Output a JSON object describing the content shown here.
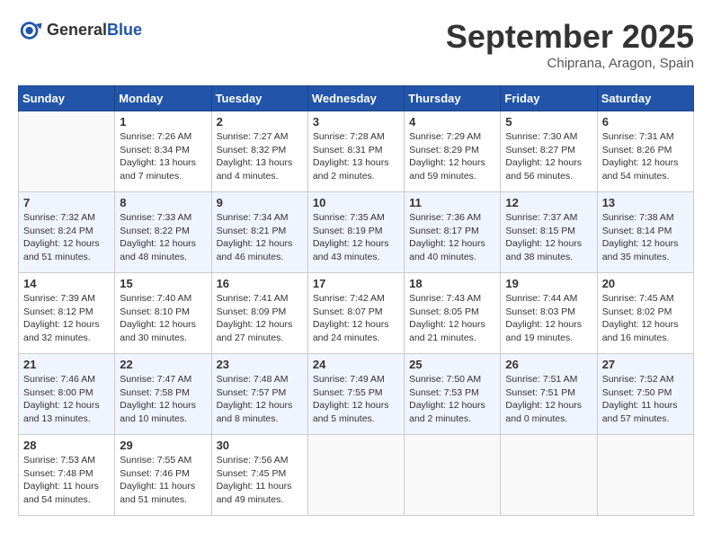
{
  "header": {
    "logo_general": "General",
    "logo_blue": "Blue",
    "month_title": "September 2025",
    "location": "Chiprana, Aragon, Spain"
  },
  "days_of_week": [
    "Sunday",
    "Monday",
    "Tuesday",
    "Wednesday",
    "Thursday",
    "Friday",
    "Saturday"
  ],
  "weeks": [
    [
      {
        "day": "",
        "info": ""
      },
      {
        "day": "1",
        "info": "Sunrise: 7:26 AM\nSunset: 8:34 PM\nDaylight: 13 hours\nand 7 minutes."
      },
      {
        "day": "2",
        "info": "Sunrise: 7:27 AM\nSunset: 8:32 PM\nDaylight: 13 hours\nand 4 minutes."
      },
      {
        "day": "3",
        "info": "Sunrise: 7:28 AM\nSunset: 8:31 PM\nDaylight: 13 hours\nand 2 minutes."
      },
      {
        "day": "4",
        "info": "Sunrise: 7:29 AM\nSunset: 8:29 PM\nDaylight: 12 hours\nand 59 minutes."
      },
      {
        "day": "5",
        "info": "Sunrise: 7:30 AM\nSunset: 8:27 PM\nDaylight: 12 hours\nand 56 minutes."
      },
      {
        "day": "6",
        "info": "Sunrise: 7:31 AM\nSunset: 8:26 PM\nDaylight: 12 hours\nand 54 minutes."
      }
    ],
    [
      {
        "day": "7",
        "info": "Sunrise: 7:32 AM\nSunset: 8:24 PM\nDaylight: 12 hours\nand 51 minutes."
      },
      {
        "day": "8",
        "info": "Sunrise: 7:33 AM\nSunset: 8:22 PM\nDaylight: 12 hours\nand 48 minutes."
      },
      {
        "day": "9",
        "info": "Sunrise: 7:34 AM\nSunset: 8:21 PM\nDaylight: 12 hours\nand 46 minutes."
      },
      {
        "day": "10",
        "info": "Sunrise: 7:35 AM\nSunset: 8:19 PM\nDaylight: 12 hours\nand 43 minutes."
      },
      {
        "day": "11",
        "info": "Sunrise: 7:36 AM\nSunset: 8:17 PM\nDaylight: 12 hours\nand 40 minutes."
      },
      {
        "day": "12",
        "info": "Sunrise: 7:37 AM\nSunset: 8:15 PM\nDaylight: 12 hours\nand 38 minutes."
      },
      {
        "day": "13",
        "info": "Sunrise: 7:38 AM\nSunset: 8:14 PM\nDaylight: 12 hours\nand 35 minutes."
      }
    ],
    [
      {
        "day": "14",
        "info": "Sunrise: 7:39 AM\nSunset: 8:12 PM\nDaylight: 12 hours\nand 32 minutes."
      },
      {
        "day": "15",
        "info": "Sunrise: 7:40 AM\nSunset: 8:10 PM\nDaylight: 12 hours\nand 30 minutes."
      },
      {
        "day": "16",
        "info": "Sunrise: 7:41 AM\nSunset: 8:09 PM\nDaylight: 12 hours\nand 27 minutes."
      },
      {
        "day": "17",
        "info": "Sunrise: 7:42 AM\nSunset: 8:07 PM\nDaylight: 12 hours\nand 24 minutes."
      },
      {
        "day": "18",
        "info": "Sunrise: 7:43 AM\nSunset: 8:05 PM\nDaylight: 12 hours\nand 21 minutes."
      },
      {
        "day": "19",
        "info": "Sunrise: 7:44 AM\nSunset: 8:03 PM\nDaylight: 12 hours\nand 19 minutes."
      },
      {
        "day": "20",
        "info": "Sunrise: 7:45 AM\nSunset: 8:02 PM\nDaylight: 12 hours\nand 16 minutes."
      }
    ],
    [
      {
        "day": "21",
        "info": "Sunrise: 7:46 AM\nSunset: 8:00 PM\nDaylight: 12 hours\nand 13 minutes."
      },
      {
        "day": "22",
        "info": "Sunrise: 7:47 AM\nSunset: 7:58 PM\nDaylight: 12 hours\nand 10 minutes."
      },
      {
        "day": "23",
        "info": "Sunrise: 7:48 AM\nSunset: 7:57 PM\nDaylight: 12 hours\nand 8 minutes."
      },
      {
        "day": "24",
        "info": "Sunrise: 7:49 AM\nSunset: 7:55 PM\nDaylight: 12 hours\nand 5 minutes."
      },
      {
        "day": "25",
        "info": "Sunrise: 7:50 AM\nSunset: 7:53 PM\nDaylight: 12 hours\nand 2 minutes."
      },
      {
        "day": "26",
        "info": "Sunrise: 7:51 AM\nSunset: 7:51 PM\nDaylight: 12 hours\nand 0 minutes."
      },
      {
        "day": "27",
        "info": "Sunrise: 7:52 AM\nSunset: 7:50 PM\nDaylight: 11 hours\nand 57 minutes."
      }
    ],
    [
      {
        "day": "28",
        "info": "Sunrise: 7:53 AM\nSunset: 7:48 PM\nDaylight: 11 hours\nand 54 minutes."
      },
      {
        "day": "29",
        "info": "Sunrise: 7:55 AM\nSunset: 7:46 PM\nDaylight: 11 hours\nand 51 minutes."
      },
      {
        "day": "30",
        "info": "Sunrise: 7:56 AM\nSunset: 7:45 PM\nDaylight: 11 hours\nand 49 minutes."
      },
      {
        "day": "",
        "info": ""
      },
      {
        "day": "",
        "info": ""
      },
      {
        "day": "",
        "info": ""
      },
      {
        "day": "",
        "info": ""
      }
    ]
  ]
}
